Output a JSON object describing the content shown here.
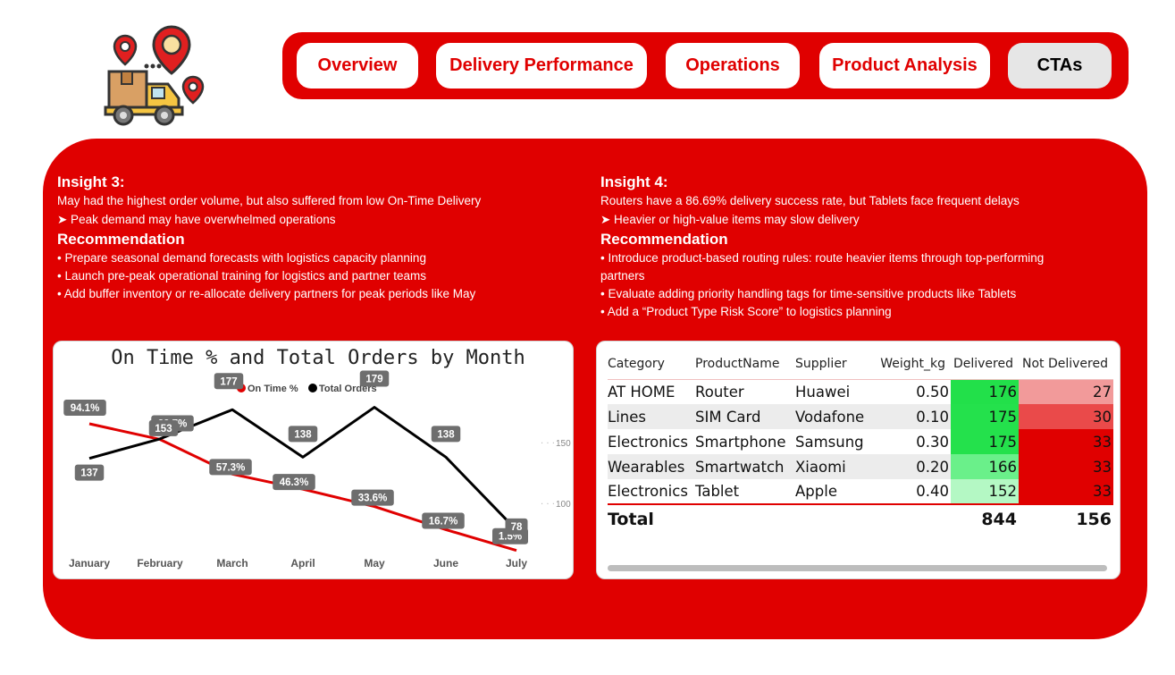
{
  "nav": {
    "tabs": [
      {
        "label": "Overview"
      },
      {
        "label": "Delivery Performance"
      },
      {
        "label": "Operations"
      },
      {
        "label": "Product Analysis"
      },
      {
        "label": "CTAs"
      }
    ],
    "active": "CTAs"
  },
  "insight3": {
    "title": "Insight 3:",
    "line1": "May had the highest order volume, but also suffered from low On-Time Delivery",
    "line2": "➤ Peak demand may have overwhelmed operations",
    "rec_title": "Recommendation",
    "bullets": [
      "• Prepare seasonal demand forecasts with logistics capacity planning",
      "• Launch pre-peak operational training for logistics and partner teams",
      "• Add buffer inventory or re-allocate delivery partners for peak periods like May"
    ]
  },
  "insight4": {
    "title": "Insight 4:",
    "line1": "Routers have a 86.69% delivery success rate, but Tablets face frequent delays",
    "line2": "➤ Heavier or high-value items may slow delivery",
    "rec_title": "Recommendation",
    "bullets": [
      "• Introduce product-based routing rules: route heavier items through top-performing",
      "partners",
      "• Evaluate adding priority handling tags for time-sensitive products like Tablets",
      "• Add a “Product Type Risk Score” to logistics planning"
    ]
  },
  "chart_data": {
    "type": "line",
    "title": "On Time % and Total Orders by Month",
    "categories": [
      "January",
      "February",
      "March",
      "April",
      "May",
      "June",
      "July"
    ],
    "series": [
      {
        "name": "On Time %",
        "color": "#e00000",
        "values": [
          94.1,
          82.7,
          57.3,
          46.3,
          33.6,
          16.7,
          1.5
        ],
        "labels": [
          "94.1%",
          "82.7%",
          "57.3%",
          "46.3%",
          "33.6%",
          "16.7%",
          "1.5%"
        ]
      },
      {
        "name": "Total Orders",
        "color": "#000000",
        "values": [
          137,
          153,
          177,
          138,
          179,
          138,
          78
        ],
        "labels": [
          "137",
          "153",
          "177",
          "138",
          "179",
          "138",
          "78"
        ]
      }
    ],
    "y2_ticks": [
      "150",
      "100"
    ],
    "legend": "top-center"
  },
  "table": {
    "columns": [
      "Category",
      "ProductName",
      "Supplier",
      "Weight_kg",
      "Delivered",
      "Not Delivered"
    ],
    "rows": [
      {
        "category": "AT HOME",
        "product": "Router",
        "supplier": "Huawei",
        "weight": "0.50",
        "delivered": "176",
        "not_delivered": "27",
        "del_color": "#22e04a",
        "nd_color": "#f29a9a"
      },
      {
        "category": "Lines",
        "product": "SIM Card",
        "supplier": "Vodafone",
        "weight": "0.10",
        "delivered": "175",
        "not_delivered": "30",
        "del_color": "#24e14c",
        "nd_color": "#ea4a4a"
      },
      {
        "category": "Electronics",
        "product": "Smartphone",
        "supplier": "Samsung",
        "weight": "0.30",
        "delivered": "175",
        "not_delivered": "33",
        "del_color": "#24e14c",
        "nd_color": "#e00000"
      },
      {
        "category": "Wearables",
        "product": "Smartwatch",
        "supplier": "Xiaomi",
        "weight": "0.20",
        "delivered": "166",
        "not_delivered": "33",
        "del_color": "#6af08a",
        "nd_color": "#e00000"
      },
      {
        "category": "Electronics",
        "product": "Tablet",
        "supplier": "Apple",
        "weight": "0.40",
        "delivered": "152",
        "not_delivered": "33",
        "del_color": "#b4f8c4",
        "nd_color": "#e00000"
      }
    ],
    "total": {
      "label": "Total",
      "delivered": "844",
      "not_delivered": "156"
    }
  }
}
